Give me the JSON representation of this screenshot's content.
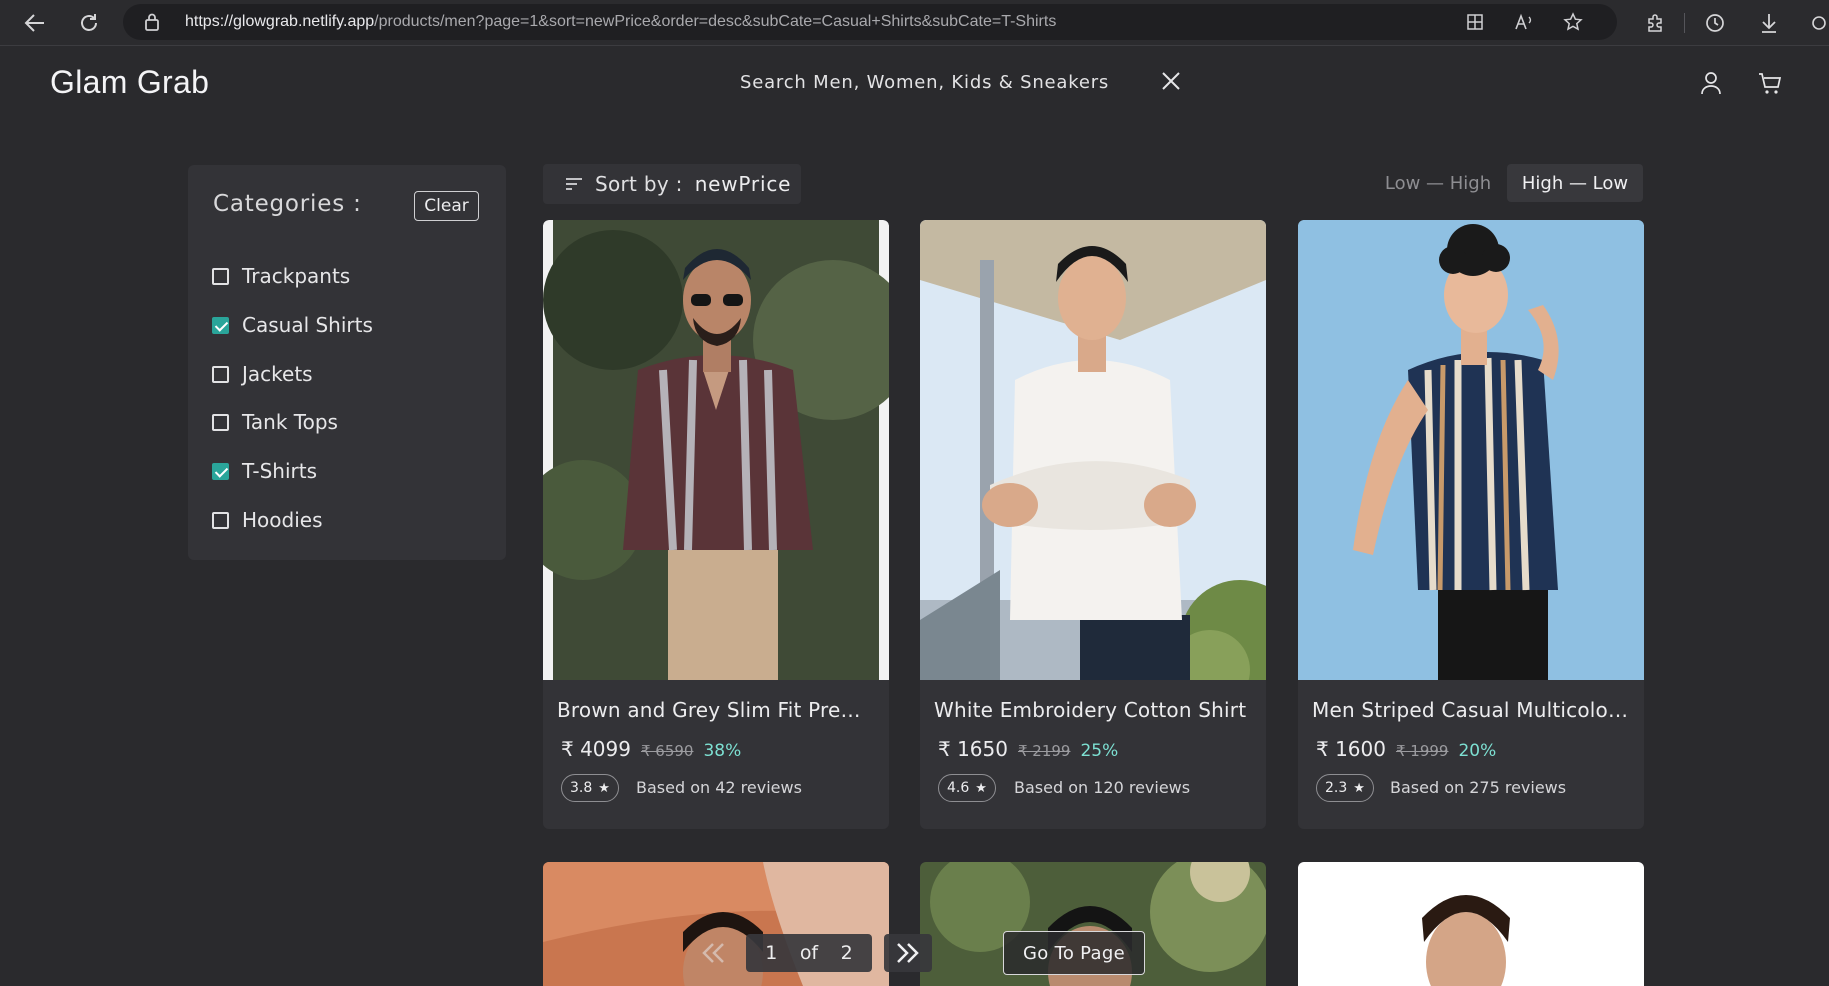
{
  "browser": {
    "url_host": "https://glowgrab.netlify.app",
    "url_path": "/products/men?page=1&sort=newPrice&order=desc&subCate=Casual+Shirts&subCate=T-Shirts"
  },
  "header": {
    "logo": "Glam Grab",
    "search_placeholder": "Search Men, Women, Kids & Sneakers"
  },
  "sidebar": {
    "title": "Categories :",
    "clear_label": "Clear",
    "categories": [
      {
        "label": "Trackpants",
        "checked": false
      },
      {
        "label": "Casual Shirts",
        "checked": true
      },
      {
        "label": "Jackets",
        "checked": false
      },
      {
        "label": "Tank Tops",
        "checked": false
      },
      {
        "label": "T-Shirts",
        "checked": true
      },
      {
        "label": "Hoodies",
        "checked": false
      }
    ]
  },
  "sort": {
    "label": "Sort by :",
    "value": "newPrice",
    "low_high": "Low — High",
    "high_low": "High — Low",
    "active": "high_low"
  },
  "products": [
    {
      "name": "Brown and Grey Slim Fit Prem...",
      "price": "₹ 4099",
      "old_price": "₹ 6590",
      "discount": "38%",
      "rating": "3.8",
      "reviews": "Based on 42 reviews"
    },
    {
      "name": "White Embroidery Cotton Shirt",
      "price": "₹ 1650",
      "old_price": "₹ 2199",
      "discount": "25%",
      "rating": "4.6",
      "reviews": "Based on 120 reviews"
    },
    {
      "name": "Men Striped Casual Multicolor...",
      "price": "₹ 1600",
      "old_price": "₹ 1999",
      "discount": "20%",
      "rating": "2.3",
      "reviews": "Based on 275 reviews"
    }
  ],
  "pagination": {
    "current": "1",
    "of_label": "of",
    "total": "2",
    "goto_label": "Go To Page"
  },
  "colors": {
    "background": "#2a2a2d",
    "panel": "#333337",
    "accent": "#2aa59a",
    "discount": "#7de0d2"
  }
}
